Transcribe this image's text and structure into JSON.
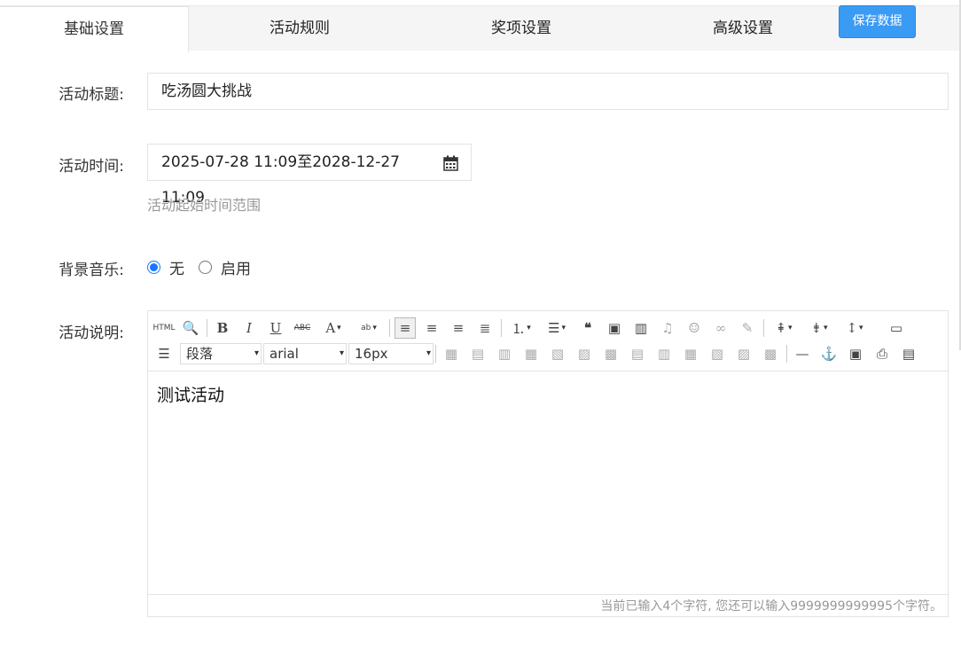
{
  "tabs": [
    {
      "label": "基础设置"
    },
    {
      "label": "活动规则"
    },
    {
      "label": "奖项设置"
    },
    {
      "label": "高级设置"
    }
  ],
  "save_button": "保存数据",
  "form": {
    "title_label": "活动标题:",
    "title_value": "吃汤圆大挑战",
    "time_label": "活动时间:",
    "time_value": "2025-07-28 11:09至2028-12-27 11:09",
    "time_help": "活动起始时间范围",
    "music_label": "背景音乐:",
    "music_options": [
      "无",
      "启用"
    ],
    "desc_label": "活动说明:"
  },
  "editor": {
    "paragraph_select": "段落",
    "font_select": "arial",
    "size_select": "16px",
    "content": "测试活动",
    "footer": "当前已输入4个字符, 您还可以输入9999999999995个字符。"
  }
}
